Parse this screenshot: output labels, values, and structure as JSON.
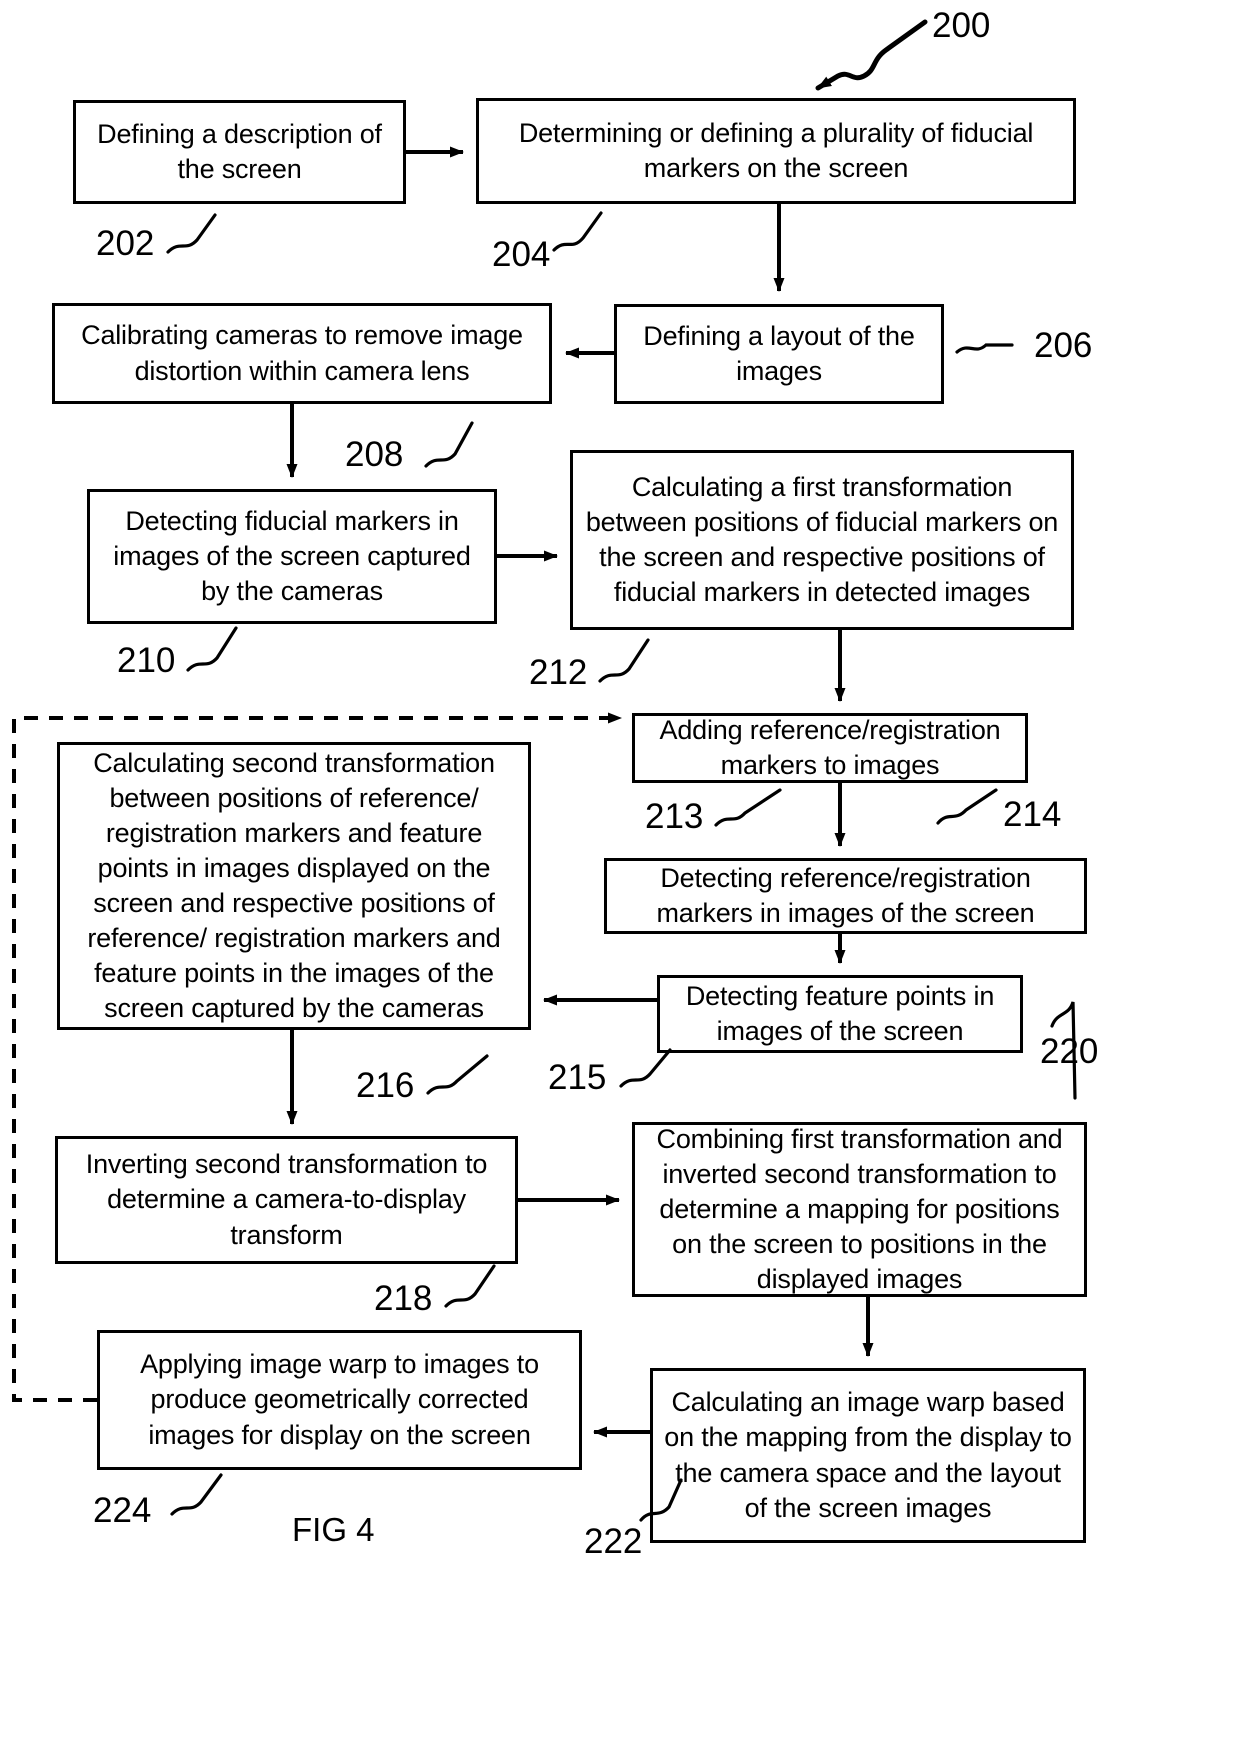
{
  "figure": {
    "label": "FIG 4",
    "diagram_ref": "200"
  },
  "boxes": [
    {
      "ref": "202",
      "text": "Defining a description of the screen"
    },
    {
      "ref": "204",
      "text": "Determining or defining a plurality of fiducial markers on the screen"
    },
    {
      "ref": "206",
      "text": "Defining a layout of the images"
    },
    {
      "ref": "208",
      "text": "Calibrating cameras to remove image distortion within camera lens"
    },
    {
      "ref": "210",
      "text": "Detecting fiducial markers in images of the screen captured by the cameras"
    },
    {
      "ref": "212",
      "text": "Calculating a first transformation between positions of fiducial markers on the screen and respective positions of fiducial markers in detected images"
    },
    {
      "ref": "213",
      "text": "Adding reference/registration markers to images"
    },
    {
      "ref": "214",
      "text": "Detecting reference/registration markers in images of the screen"
    },
    {
      "ref": "215",
      "text": "Detecting feature points in images of the screen"
    },
    {
      "ref": "216",
      "text": "Calculating second transformation between positions of reference/ registration markers and feature points in images displayed on the screen and respective positions of reference/ registration markers and feature points in the images of the screen captured by the cameras"
    },
    {
      "ref": "218",
      "text": "Inverting second transformation to determine a camera-to-display transform"
    },
    {
      "ref": "220",
      "text": "Combining first transformation and inverted second transformation to determine a mapping for positions on the screen to positions in the displayed images"
    },
    {
      "ref": "222",
      "text": "Calculating an image warp based on the mapping from the display to the camera space and the layout of the screen images"
    },
    {
      "ref": "224",
      "text": "Applying image warp to images to produce geometrically corrected images for display on the screen"
    }
  ]
}
